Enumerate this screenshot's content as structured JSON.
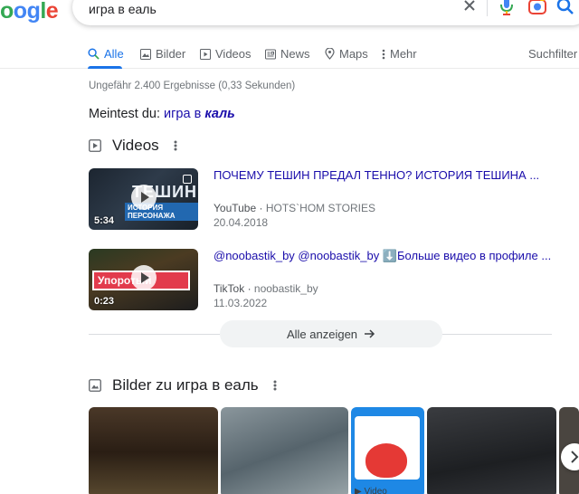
{
  "header": {
    "logo_text": "oogle",
    "query": "игра в еаль"
  },
  "tabs": [
    {
      "label": "Alle",
      "icon": "search-icon"
    },
    {
      "label": "Bilder",
      "icon": "image-icon"
    },
    {
      "label": "Videos",
      "icon": "play-icon"
    },
    {
      "label": "News",
      "icon": "news-icon"
    },
    {
      "label": "Maps",
      "icon": "map-pin-icon"
    },
    {
      "label": "Mehr",
      "icon": "more-vert-icon"
    }
  ],
  "tools_label": "Suchfilter",
  "result_stats": "Ungefähr 2.400 Ergebnisse (0,33 Sekunden)",
  "did_you_mean": {
    "prefix": "Meintest du:",
    "suggestion_plain": "игра в",
    "suggestion_bold": "каль"
  },
  "videos": {
    "title": "Videos",
    "items": [
      {
        "thumb_text": "ТЕШИН",
        "thumb_sub": "ИСТОРИЯ ПЕРСОНАЖА",
        "duration": "5:34",
        "title": "ПОЧЕМУ ТЕШИН ПРЕДАЛ ТЕННО? ИСТОРИЯ ТЕШИНА ...",
        "source": "YouTube",
        "author": "HOTS`HOM STORIES",
        "date": "20.04.2018"
      },
      {
        "thumb_text": "Упоротый",
        "duration": "0:23",
        "title": "@noobastik_by @noobastik_by ⬇️Больше видео в профиле ...",
        "source": "TikTok",
        "author": "noobastik_by",
        "date": "11.03.2022"
      }
    ],
    "show_all": "Alle anzeigen"
  },
  "images": {
    "title": "Bilder zu игра в еаль",
    "cells": [
      {
        "color": "#3b2a1c"
      },
      {
        "color": "#6a7a84"
      },
      {
        "color": "#1e88e5"
      },
      {
        "color": "#2d2f33"
      },
      {
        "color": "#4a4540"
      }
    ],
    "video_tag": "Video"
  },
  "colors": {
    "accent": "#1a73e8",
    "link": "#1a0dab"
  }
}
